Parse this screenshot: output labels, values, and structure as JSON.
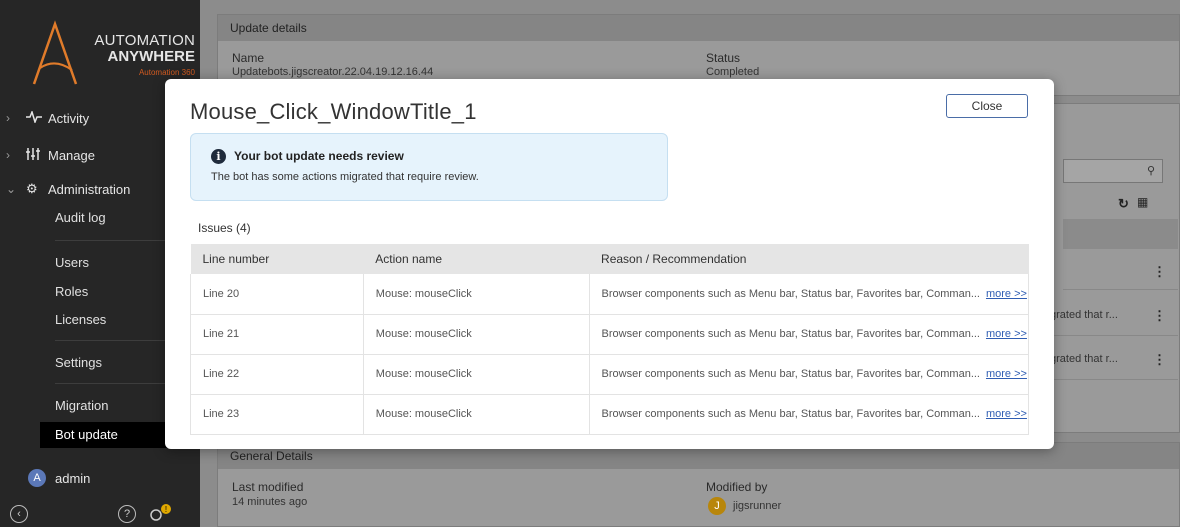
{
  "sidebar": {
    "logo": {
      "line1": "AUTOMATION",
      "line2": "ANYWHERE",
      "line3": "Automation 360"
    },
    "nav": [
      {
        "label": "Activity",
        "chevron": "›",
        "icon": "activity-icon"
      },
      {
        "label": "Manage",
        "chevron": "›",
        "icon": "manage-icon"
      },
      {
        "label": "Administration",
        "chevron": "⌄",
        "icon": "gear-icon"
      }
    ],
    "subitems": [
      "Audit log",
      "Users",
      "Roles",
      "Licenses",
      "Settings",
      "Migration",
      "Bot update"
    ],
    "active": "Bot update",
    "user": {
      "initial": "A",
      "name": "admin"
    }
  },
  "background": {
    "update_details": {
      "heading": "Update details",
      "name_label": "Name",
      "name_value": "Updatebots.jigscreator.22.04.19.12.16.44",
      "status_label": "Status",
      "status_value": "Completed"
    },
    "partial_rows": [
      "grated that r...",
      "grated that r..."
    ],
    "general": {
      "heading": "General Details",
      "last_modified_label": "Last modified",
      "last_modified_value": "14 minutes ago",
      "modified_by_label": "Modified by",
      "modified_by_initial": "J",
      "modified_by_value": "jigsrunner"
    }
  },
  "modal": {
    "title": "Mouse_Click_WindowTitle_1",
    "close_label": "Close",
    "alert": {
      "title": "Your bot update needs review",
      "text": "The bot has some actions migrated that require review."
    },
    "issues_label": "Issues (4)",
    "table": {
      "columns": [
        "Line number",
        "Action name",
        "Reason / Recommendation"
      ],
      "rows": [
        {
          "line": "Line 20",
          "action": "Mouse: mouseClick",
          "reason": "Browser components such as Menu bar, Status bar, Favorites bar, Comman...",
          "more": "more >>"
        },
        {
          "line": "Line 21",
          "action": "Mouse: mouseClick",
          "reason": "Browser components such as Menu bar, Status bar, Favorites bar, Comman...",
          "more": "more >>"
        },
        {
          "line": "Line 22",
          "action": "Mouse: mouseClick",
          "reason": "Browser components such as Menu bar, Status bar, Favorites bar, Comman...",
          "more": "more >>"
        },
        {
          "line": "Line 23",
          "action": "Mouse: mouseClick",
          "reason": "Browser components such as Menu bar, Status bar, Favorites bar, Comman...",
          "more": "more >>"
        }
      ]
    }
  }
}
